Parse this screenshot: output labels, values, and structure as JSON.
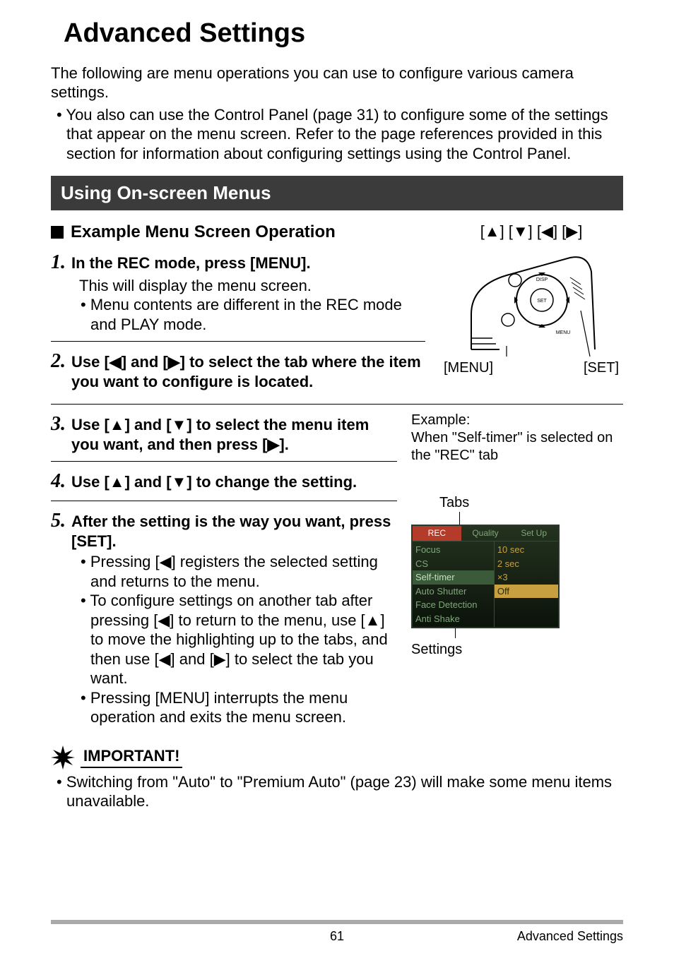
{
  "title": "Advanced Settings",
  "intro": "The following are menu operations you can use to configure various camera settings.",
  "intro_bullet": "You also can use the Control Panel (page 31) to configure some of the settings that appear on the menu screen. Refer to the page references provided in this section for information about configuring settings using the Control Panel.",
  "section_bar": "Using On-screen Menus",
  "subheading": "Example Menu Screen Operation",
  "dpad_label": "[▲] [▼] [◀] [▶]",
  "btn_menu": "[MENU]",
  "btn_set": "[SET]",
  "diagram_labels": {
    "disp": "DISP",
    "set": "SET",
    "menu": "MENU"
  },
  "steps": [
    {
      "num": "1.",
      "title": "In the REC mode, press [MENU].",
      "body": "This will display the menu screen.",
      "bullets": [
        "Menu contents are different in the REC mode and PLAY mode."
      ]
    },
    {
      "num": "2.",
      "title": "Use [◀] and [▶] to select the tab where the item you want to configure is located."
    },
    {
      "num": "3.",
      "title": "Use [▲] and [▼] to select the menu item you want, and then press [▶]."
    },
    {
      "num": "4.",
      "title": "Use [▲] and [▼] to change the setting."
    },
    {
      "num": "5.",
      "title": "After the setting is the way you want, press [SET].",
      "bullets": [
        "Pressing [◀] registers the selected setting and returns to the menu.",
        "To configure settings on another tab after pressing [◀] to return to the menu, use [▲] to move the highlighting up to the tabs, and then use [◀] and [▶] to select the tab you want.",
        "Pressing [MENU] interrupts the menu operation and exits the menu screen."
      ]
    }
  ],
  "example": {
    "heading": "Example:",
    "text": "When \"Self-timer\" is selected on the \"REC\" tab"
  },
  "tabs_label": "Tabs",
  "settings_label": "Settings",
  "menu": {
    "tabs": [
      "REC",
      "Quality",
      "Set Up"
    ],
    "left": [
      "Focus",
      "CS",
      "Self-timer",
      "Auto Shutter",
      "Face Detection",
      "Anti Shake"
    ],
    "right": [
      "10 sec",
      "2 sec",
      "×3",
      "Off"
    ]
  },
  "important_label": "IMPORTANT!",
  "important_text": "Switching from \"Auto\" to \"Premium Auto\" (page 23) will make some menu items unavailable.",
  "footer": {
    "page": "61",
    "section": "Advanced Settings"
  }
}
